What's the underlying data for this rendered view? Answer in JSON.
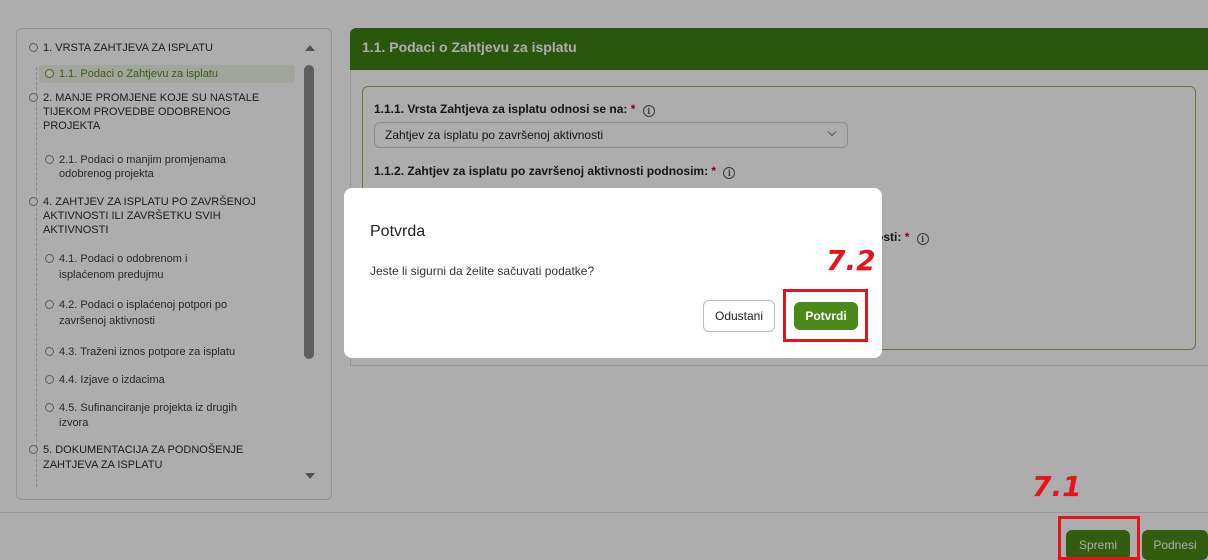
{
  "nav": {
    "items": [
      {
        "label": "1. VRSTA ZAHTJEVA ZA ISPLATU"
      },
      {
        "label": "1.1. Podaci o Zahtjevu za isplatu"
      },
      {
        "label_lines": [
          "2. MANJE PROMJENE KOJE SU NASTALE",
          "TIJEKOM PROVEDBE ODOBRENOG",
          "PROJEKTA"
        ]
      },
      {
        "label_lines": [
          "2.1. Podaci o manjim promjenama",
          "odobrenog projekta"
        ]
      },
      {
        "label_lines": [
          "4. ZAHTJEV ZA ISPLATU PO ZAVRŠENOJ",
          "AKTIVNOSTI ILI ZAVRŠETKU SVIH",
          "AKTIVNOSTI"
        ]
      },
      {
        "label_lines": [
          "4.1. Podaci o odobrenom i",
          "isplaćenom predujmu"
        ]
      },
      {
        "label_lines": [
          "4.2. Podaci o isplaćenoj potpori po",
          "završenoj aktivnosti"
        ]
      },
      {
        "label": "4.3. Traženi iznos potpore za isplatu"
      },
      {
        "label": "4.4. Izjave o izdacima"
      },
      {
        "label_lines": [
          "4.5. Sufinanciranje projekta iz drugih",
          "izvora"
        ]
      },
      {
        "label_lines": [
          "5. DOKUMENTACIJA ZA PODNOŠENJE",
          "ZAHTJEVA ZA ISPLATU"
        ]
      }
    ]
  },
  "section": {
    "title": "1.1. Podaci o Zahtjevu za isplatu",
    "field1_label": "1.1.1. Vrsta Zahtjeva za isplatu odnosi se na:",
    "field1_value": "Zahtjev za isplatu po završenoj aktivnosti",
    "field2_label": "1.1.2. Zahtjev za isplatu po završenoj aktivnosti podnosim:",
    "field3_label_fragment": "osti:",
    "required_mark": "*",
    "info_glyph": "i"
  },
  "footer": {
    "save_label": "Spremi",
    "submit_label": "Podnesi"
  },
  "modal": {
    "title": "Potvrda",
    "message": "Jeste li sigurni da želite sačuvati podatke?",
    "cancel_label": "Odustani",
    "confirm_label": "Potvrdi"
  },
  "annotations": {
    "step_confirm": "7.2",
    "step_save": "7.1"
  },
  "colors": {
    "accent_green": "#4b8a17",
    "header_green": "#3e7f14",
    "annotation_red": "#e3141b"
  }
}
